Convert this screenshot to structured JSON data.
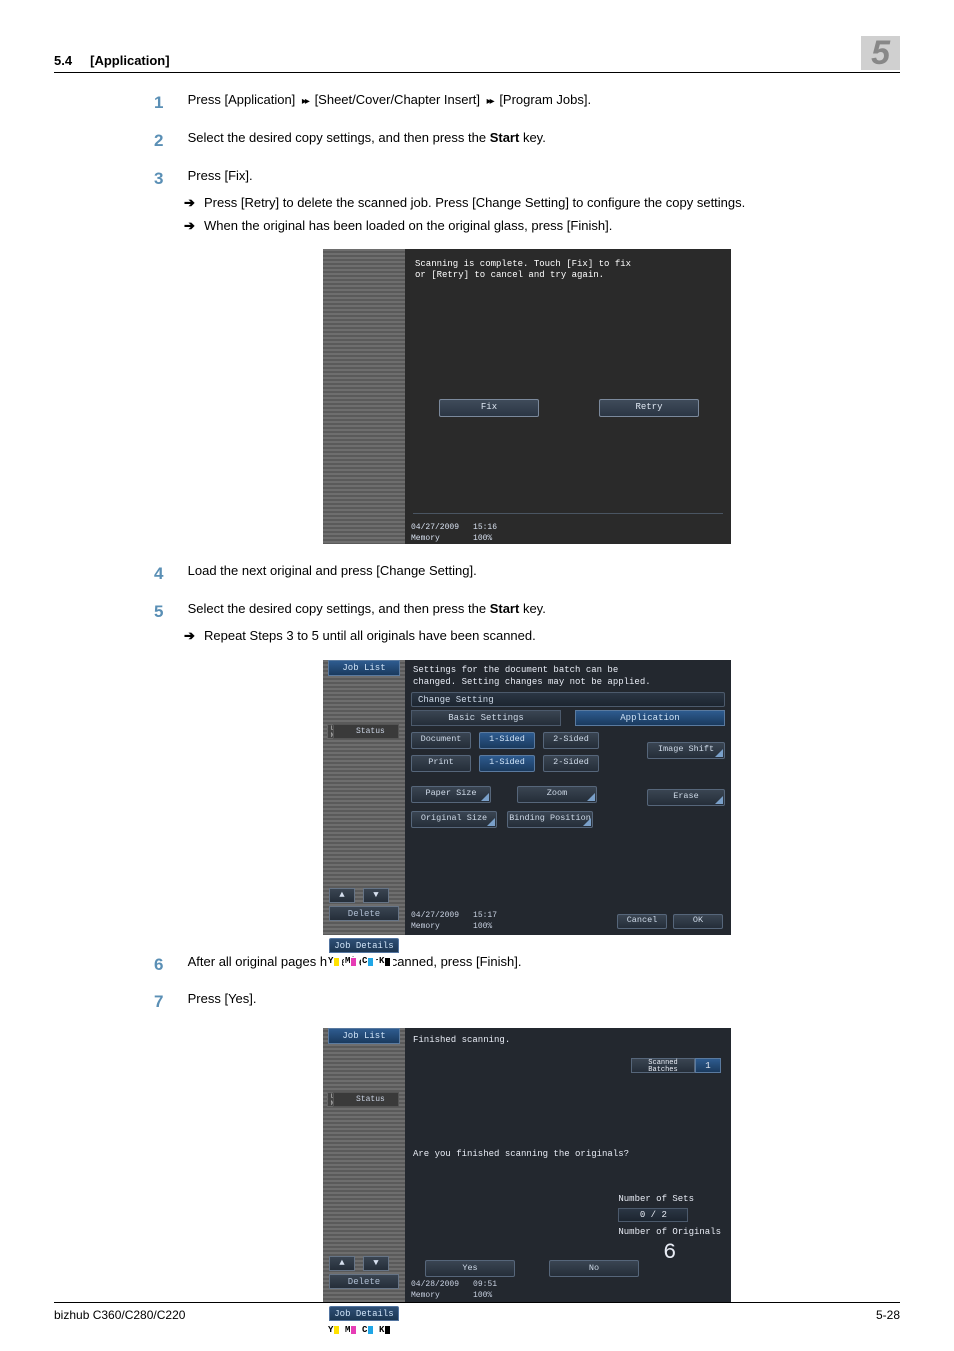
{
  "header": {
    "section": "5.4",
    "title": "[Application]",
    "chapter_glyph": "5"
  },
  "steps": {
    "s1": {
      "n": "1",
      "text_a": "Press [Application] ",
      "text_b": " [Sheet/Cover/Chapter Insert] ",
      "text_c": " [Program Jobs]."
    },
    "s2": {
      "n": "2",
      "text_a": "Select the desired copy settings, and then press the ",
      "bold": "Start",
      "text_b": " key."
    },
    "s3": {
      "n": "3",
      "text": "Press [Fix].",
      "sub1": "Press [Retry] to delete the scanned job. Press [Change Setting] to configure the copy settings.",
      "sub2": "When the original has been loaded on the original glass, press [Finish]."
    },
    "s4": {
      "n": "4",
      "text": "Load the next original and press [Change Setting]."
    },
    "s5": {
      "n": "5",
      "text_a": "Select the desired copy settings, and then press the ",
      "bold": "Start",
      "text_b": " key.",
      "sub1": "Repeat Steps 3 to 5 until all originals have been scanned."
    },
    "s6": {
      "n": "6",
      "text": "After all original pages have been scanned, press [Finish]."
    },
    "s7": {
      "n": "7",
      "text": "Press [Yes]."
    }
  },
  "panel1": {
    "msg": "Scanning is complete. Touch [Fix] to fix\nor [Retry] to cancel and try again.",
    "fix": "Fix",
    "retry": "Retry",
    "date": "04/27/2009",
    "time": "15:16",
    "mem": "Memory",
    "pct": "100%"
  },
  "panel2": {
    "joblist": "Job List",
    "header": "Settings for the document batch can be\nchanged. Setting changes may not be applied.",
    "change_setting": "Change Setting",
    "basic_settings": "Basic Settings",
    "application": "Application",
    "document": "Document",
    "one_sided": "1-Sided",
    "two_sided": "2-Sided",
    "print": "Print",
    "paper_size": "Paper Size",
    "zoom": "Zoom",
    "original_size": "Original Size",
    "binding": "Binding Position",
    "image_shift": "Image Shift",
    "erase": "Erase",
    "status": "Status",
    "user": "User\nName",
    "delete": "Delete",
    "job_details": "Job Details",
    "cancel": "Cancel",
    "ok": "OK",
    "date": "04/27/2009",
    "time": "15:17",
    "mem": "Memory",
    "pct": "100%",
    "toner": {
      "y": "Y",
      "m": "M",
      "c": "C",
      "k": "K"
    }
  },
  "panel3": {
    "joblist": "Job List",
    "finished": "Finished scanning.",
    "scanned_label": "Scanned\nBatches",
    "scanned_n": "1",
    "question": "Are you finished scanning the originals?",
    "num_sets": "Number of Sets",
    "sets_val": "0 / 2",
    "num_orig": "Number of Originals",
    "orig_n": "6",
    "yes": "Yes",
    "no": "No",
    "status": "Status",
    "user": "User\nName",
    "delete": "Delete",
    "job_details": "Job Details",
    "date": "04/28/2009",
    "time": "09:51",
    "mem": "Memory",
    "pct": "100%",
    "toner": {
      "y": "Y",
      "m": "M",
      "c": "C",
      "k": "K"
    }
  },
  "footer": {
    "model": "bizhub C360/C280/C220",
    "page": "5-28"
  }
}
